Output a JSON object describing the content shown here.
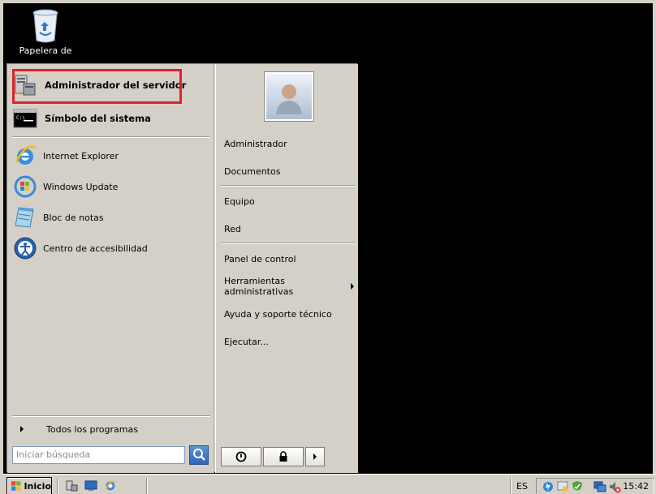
{
  "desktop": {
    "icon_label": "Papelera de"
  },
  "start_menu": {
    "pinned": [
      {
        "label": "Administrador del servidor"
      },
      {
        "label": "Símbolo del sistema"
      }
    ],
    "recent": [
      {
        "label": "Internet Explorer"
      },
      {
        "label": "Windows Update"
      },
      {
        "label": "Bloc de notas"
      },
      {
        "label": "Centro de accesibilidad"
      }
    ],
    "all_programs": "Todos los programas",
    "search_placeholder": "Iniciar búsqueda",
    "right_items": [
      {
        "label": "Administrador"
      },
      {
        "label": "Documentos"
      },
      {
        "label": "Equipo"
      },
      {
        "label": "Red"
      },
      {
        "label": "Panel de control"
      },
      {
        "label": "Herramientas administrativas"
      },
      {
        "label": "Ayuda y soporte técnico"
      },
      {
        "label": "Ejecutar..."
      }
    ]
  },
  "taskbar": {
    "start_label": "Inicio",
    "language": "ES",
    "clock": "15:42"
  },
  "colors": {
    "highlight_border": "#e3202a",
    "menu_bg": "#d4d0c8"
  }
}
